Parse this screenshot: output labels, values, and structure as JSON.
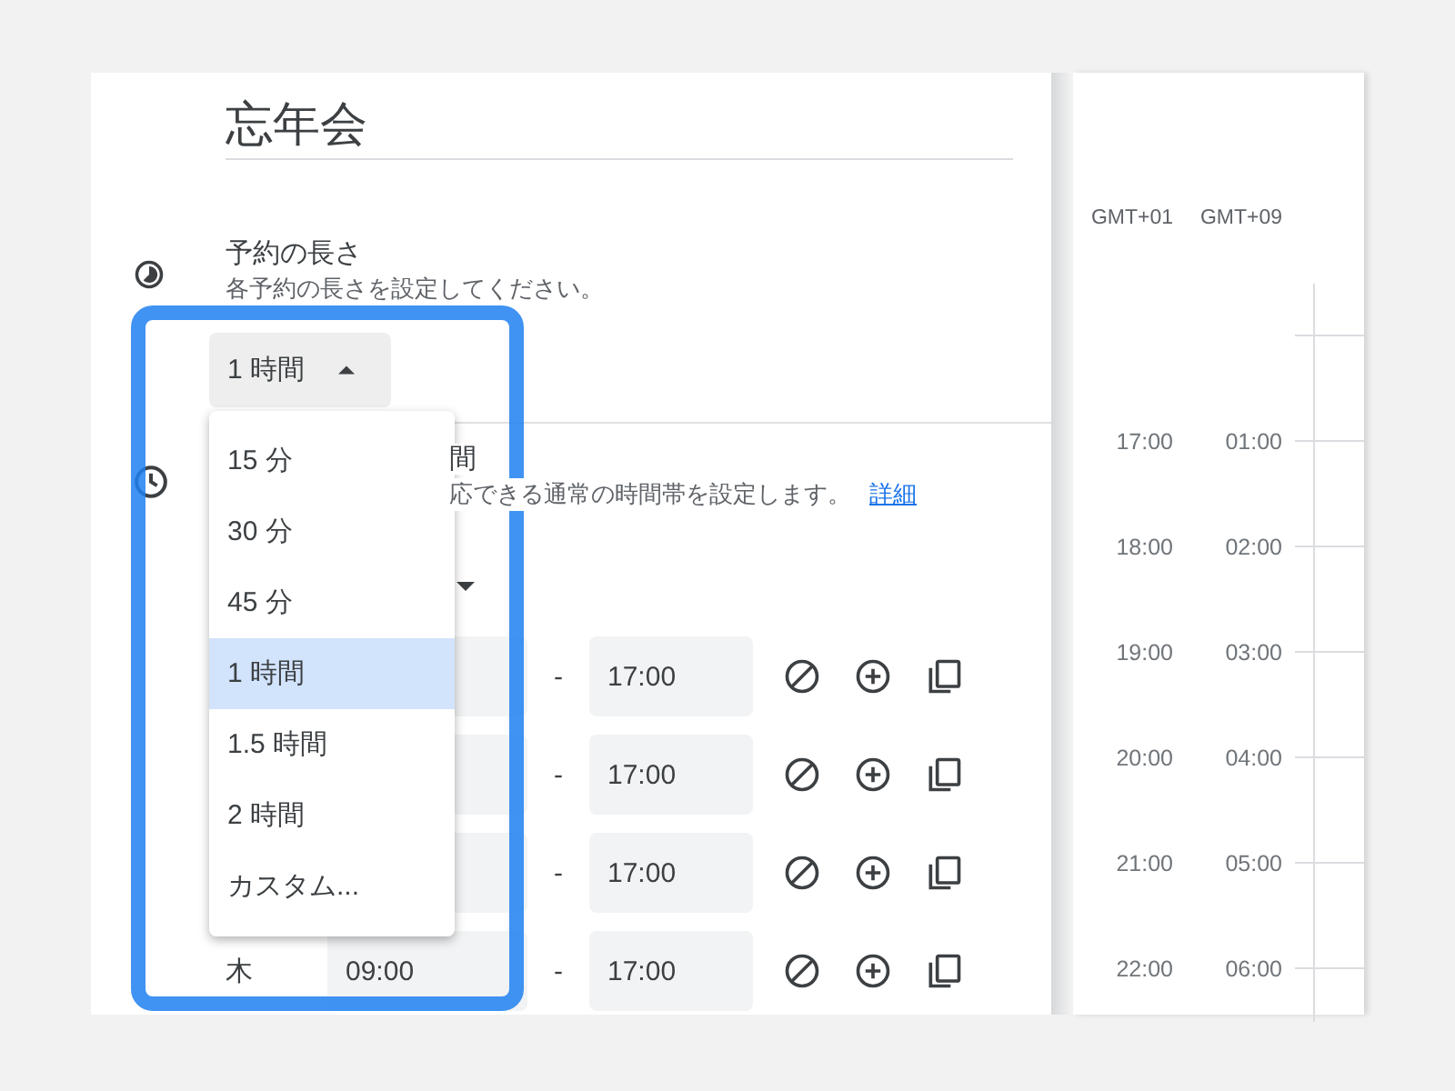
{
  "title": "忘年会",
  "duration": {
    "title": "予約の長さ",
    "description": "各予約の長さを設定してください。",
    "value": "1 時間",
    "expanded": true,
    "options": [
      {
        "label": "15 分",
        "selected": false
      },
      {
        "label": "30 分",
        "selected": false
      },
      {
        "label": "45 分",
        "selected": false
      },
      {
        "label": "1 時間",
        "selected": true
      },
      {
        "label": "1.5 時間",
        "selected": false
      },
      {
        "label": "2 時間",
        "selected": false
      },
      {
        "label": "カスタム...",
        "selected": false
      }
    ]
  },
  "availability": {
    "title": "間",
    "description": "応できる通常の時間帯を設定します。",
    "link": "詳細",
    "rows": [
      {
        "separator": "-",
        "end": "17:00"
      },
      {
        "separator": "-",
        "end": "17:00"
      },
      {
        "separator": "-",
        "end": "17:00"
      },
      {
        "day": "木",
        "start": "09:00",
        "separator": "-",
        "end": "17:00"
      }
    ]
  },
  "timeline": {
    "zones": [
      "GMT+01",
      "GMT+09"
    ],
    "rows": [
      {},
      {
        "a": "17:00",
        "b": "01:00"
      },
      {
        "a": "18:00",
        "b": "02:00"
      },
      {
        "a": "19:00",
        "b": "03:00"
      },
      {
        "a": "20:00",
        "b": "04:00"
      },
      {
        "a": "21:00",
        "b": "05:00"
      },
      {
        "a": "22:00",
        "b": "06:00"
      }
    ]
  }
}
